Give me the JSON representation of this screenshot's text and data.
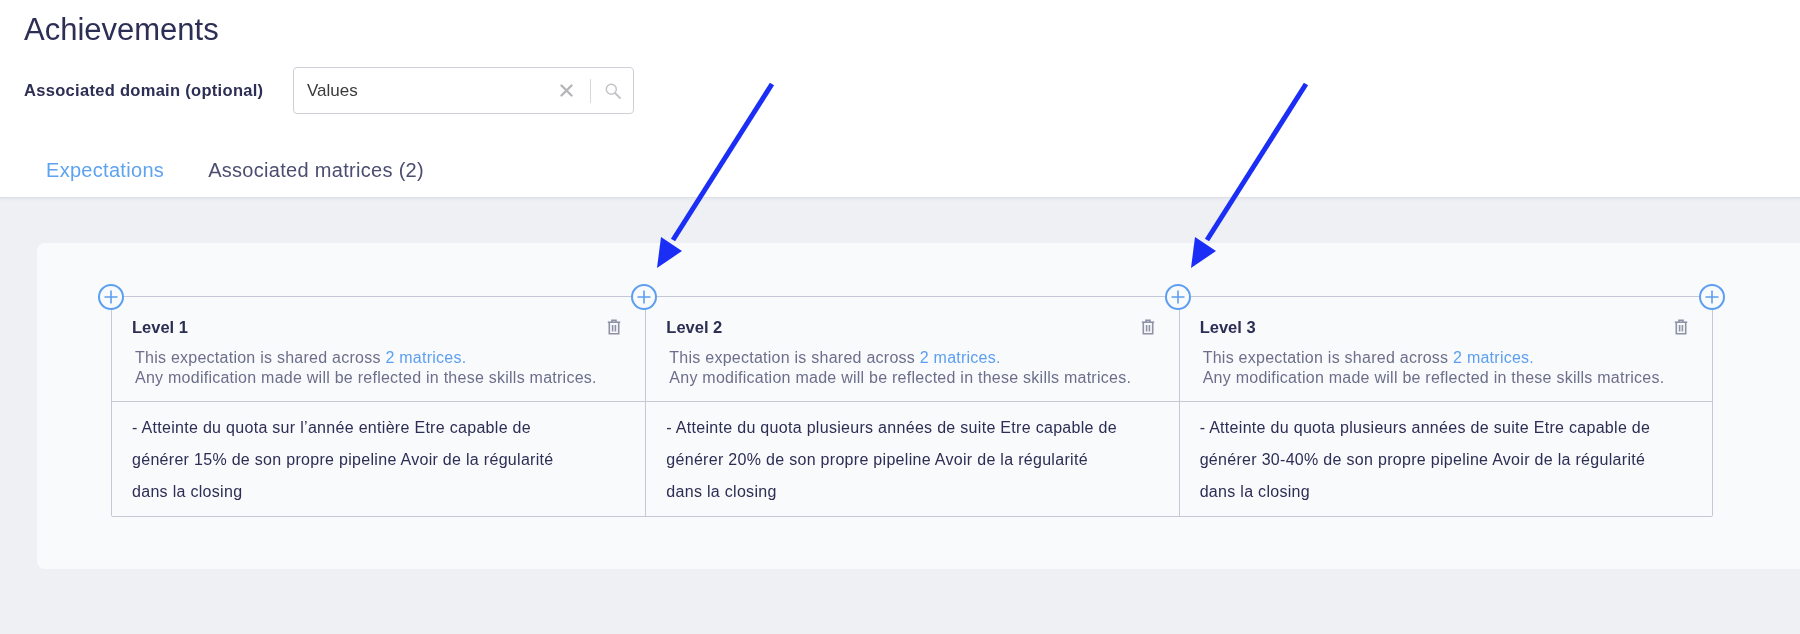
{
  "page": {
    "title": "Achievements"
  },
  "domain_field": {
    "label": "Associated domain (optional)",
    "value": "Values"
  },
  "tabs": [
    {
      "label": "Expectations",
      "selected": true
    },
    {
      "label": "Associated matrices (2)",
      "selected": false
    }
  ],
  "insert_buttons": [
    {
      "annotated": false
    },
    {
      "annotated": true
    },
    {
      "annotated": true
    },
    {
      "annotated": false
    }
  ],
  "levels": [
    {
      "title": "Level 1",
      "shared_text": "This expectation is shared across",
      "shared_link": "2 matrices.",
      "warning": "Any modification made will be reflected in these skills matrices.",
      "description": "- Atteinte du quota sur l’année entière Etre capable de générer 15% de son propre pipeline Avoir de la régularité dans la closing"
    },
    {
      "title": "Level 2",
      "shared_text": "This expectation is shared across",
      "shared_link": "2 matrices.",
      "warning": "Any modification made will be reflected in these skills matrices.",
      "description": "- Atteinte du quota plusieurs années de suite Etre capable de générer 20% de son propre pipeline Avoir de la régularité dans la closing"
    },
    {
      "title": "Level 3",
      "shared_text": "This expectation is shared across",
      "shared_link": "2 matrices.",
      "warning": "Any modification made will be reflected in these skills matrices.",
      "description": "- Atteinte du quota plusieurs années de suite Etre capable de générer 30-40% de son propre pipeline Avoir de la régularité dans la closing"
    }
  ]
}
